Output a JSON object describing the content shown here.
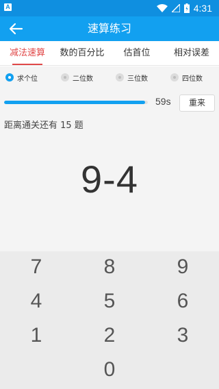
{
  "status_bar": {
    "left_icon_letter": "A",
    "time": "4:31"
  },
  "app_bar": {
    "back_icon": "arrow-left-icon",
    "title": "速算练习"
  },
  "tabs": [
    {
      "label": "减法速算",
      "active": true
    },
    {
      "label": "数的百分比",
      "active": false
    },
    {
      "label": "估首位",
      "active": false
    },
    {
      "label": "相对误差",
      "active": false
    }
  ],
  "digit_options": [
    {
      "label": "求个位",
      "selected": true
    },
    {
      "label": "二位数",
      "selected": false
    },
    {
      "label": "三位数",
      "selected": false
    },
    {
      "label": "四位数",
      "selected": false
    }
  ],
  "timer": {
    "progress_fraction": 0.98,
    "seconds_label": "59s",
    "restart_label": "重来"
  },
  "remaining_text": "距离通关还有 15 题",
  "problem": "9-4",
  "keypad": {
    "keys": [
      "7",
      "8",
      "9",
      "4",
      "5",
      "6",
      "1",
      "2",
      "3",
      "0"
    ]
  },
  "colors": {
    "primary": "#12a0f0",
    "status_bar": "#0f8fe0",
    "active_tab": "#e04848"
  }
}
